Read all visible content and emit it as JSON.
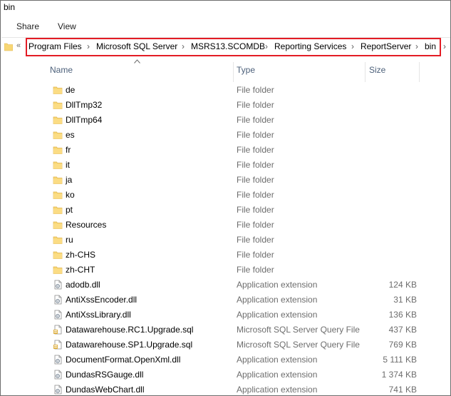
{
  "window": {
    "title": "bin"
  },
  "ribbon": {
    "tabs": [
      "Share",
      "View"
    ]
  },
  "address": {
    "overflow": "«",
    "crumbs": [
      "Program Files",
      "Microsoft SQL Server",
      "MSRS13.SCOMDB",
      "Reporting Services",
      "ReportServer",
      "bin"
    ],
    "separator": "›"
  },
  "columns": {
    "name": "Name",
    "type": "Type",
    "size": "Size"
  },
  "files": [
    {
      "name": "de",
      "type": "File folder",
      "size": "",
      "icon": "folder-icon"
    },
    {
      "name": "DllTmp32",
      "type": "File folder",
      "size": "",
      "icon": "folder-icon"
    },
    {
      "name": "DllTmp64",
      "type": "File folder",
      "size": "",
      "icon": "folder-icon"
    },
    {
      "name": "es",
      "type": "File folder",
      "size": "",
      "icon": "folder-icon"
    },
    {
      "name": "fr",
      "type": "File folder",
      "size": "",
      "icon": "folder-icon"
    },
    {
      "name": "it",
      "type": "File folder",
      "size": "",
      "icon": "folder-icon"
    },
    {
      "name": "ja",
      "type": "File folder",
      "size": "",
      "icon": "folder-icon"
    },
    {
      "name": "ko",
      "type": "File folder",
      "size": "",
      "icon": "folder-icon"
    },
    {
      "name": "pt",
      "type": "File folder",
      "size": "",
      "icon": "folder-icon"
    },
    {
      "name": "Resources",
      "type": "File folder",
      "size": "",
      "icon": "folder-icon"
    },
    {
      "name": "ru",
      "type": "File folder",
      "size": "",
      "icon": "folder-icon"
    },
    {
      "name": "zh-CHS",
      "type": "File folder",
      "size": "",
      "icon": "folder-icon"
    },
    {
      "name": "zh-CHT",
      "type": "File folder",
      "size": "",
      "icon": "folder-icon"
    },
    {
      "name": "adodb.dll",
      "type": "Application extension",
      "size": "124 KB",
      "icon": "dll-icon"
    },
    {
      "name": "AntiXssEncoder.dll",
      "type": "Application extension",
      "size": "31 KB",
      "icon": "dll-icon"
    },
    {
      "name": "AntiXssLibrary.dll",
      "type": "Application extension",
      "size": "136 KB",
      "icon": "dll-icon"
    },
    {
      "name": "Datawarehouse.RC1.Upgrade.sql",
      "type": "Microsoft SQL Server Query File",
      "size": "437 KB",
      "icon": "sql-file-icon"
    },
    {
      "name": "Datawarehouse.SP1.Upgrade.sql",
      "type": "Microsoft SQL Server Query File",
      "size": "769 KB",
      "icon": "sql-file-icon"
    },
    {
      "name": "DocumentFormat.OpenXml.dll",
      "type": "Application extension",
      "size": "5 111 KB",
      "icon": "dll-icon"
    },
    {
      "name": "DundasRSGauge.dll",
      "type": "Application extension",
      "size": "1 374 KB",
      "icon": "dll-icon"
    },
    {
      "name": "DundasWebChart.dll",
      "type": "Application extension",
      "size": "741 KB",
      "icon": "dll-icon"
    }
  ],
  "colors": {
    "highlight": "#e31c25",
    "folder": "#f8d775",
    "folderDark": "#e0b44c",
    "header": "#4c607a",
    "secondary": "#6d6d6d"
  }
}
